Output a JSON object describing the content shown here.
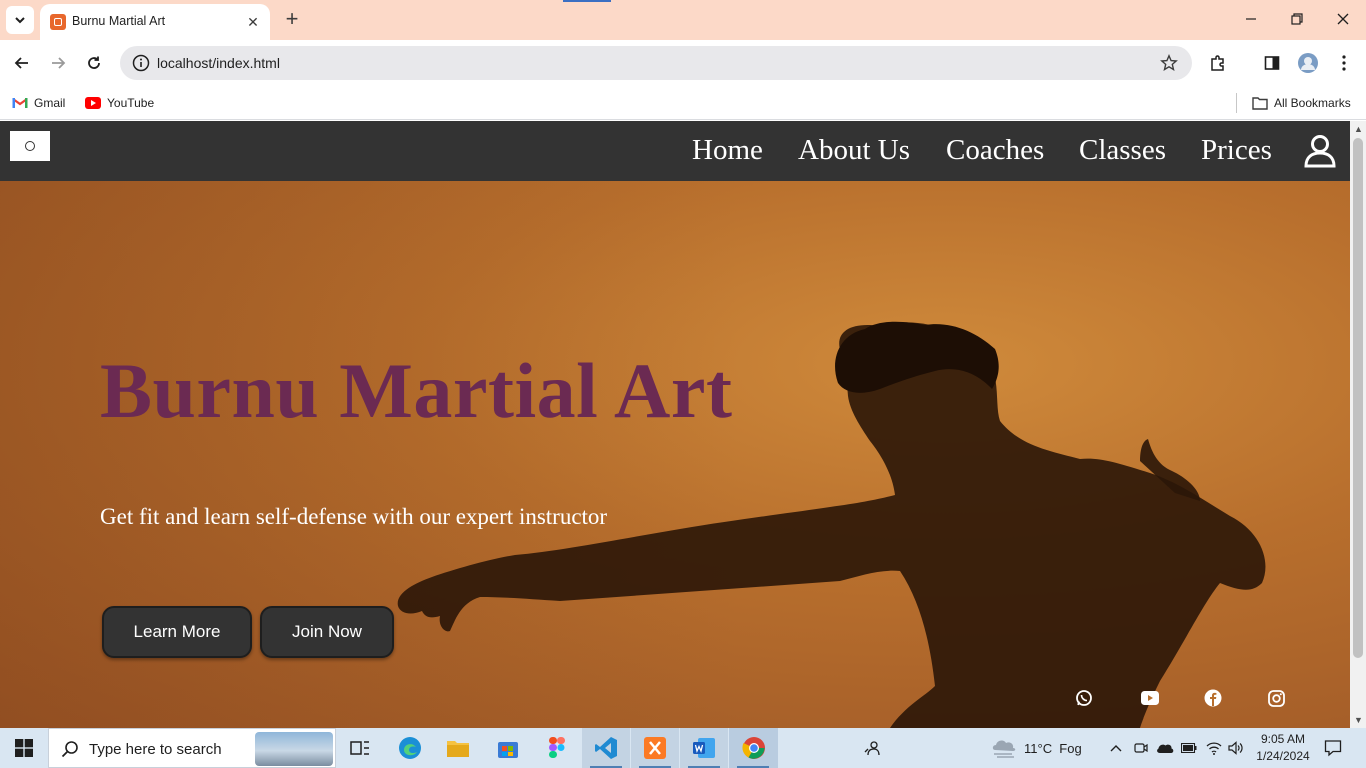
{
  "browser": {
    "tab_title": "Burnu Martial Art",
    "url": "localhost/index.html",
    "bookmarks": [
      {
        "label": "Gmail",
        "icon": "gmail-icon"
      },
      {
        "label": "YouTube",
        "icon": "youtube-icon"
      }
    ],
    "all_bookmarks_label": "All Bookmarks"
  },
  "site": {
    "nav": {
      "items": [
        "Home",
        "About Us",
        "Coaches",
        "Classes",
        "Prices"
      ]
    },
    "hero": {
      "title": "Burnu Martial Art",
      "subtitle": "Get fit and learn self-defense with our expert instructor",
      "learn_more": "Learn More",
      "join_now": "Join Now"
    },
    "socials": [
      "whatsapp-icon",
      "youtube-icon",
      "facebook-icon",
      "instagram-icon"
    ],
    "colors": {
      "nav_bg": "#333333",
      "title_color": "#6b2a52",
      "hero_bg": "#c27a32"
    }
  },
  "taskbar": {
    "search_placeholder": "Type here to search",
    "weather": "11°C  Fog",
    "time": "9:05 AM",
    "date": "1/24/2024"
  }
}
